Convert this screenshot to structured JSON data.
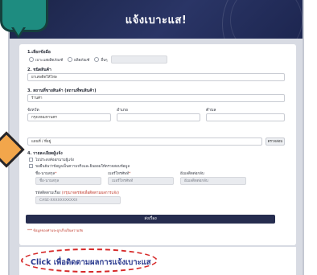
{
  "header": {
    "title": "แจ้งเบาะแส!"
  },
  "form": {
    "section1_label": "1.เลือกข้อมือ",
    "radio_options": [
      "เบาะแสผลิตภัณฑ์",
      "ผลิตภัณฑ์",
      "อื่นๆ"
    ],
    "section2_label": "2. ชนิดสินค้า",
    "product_type_value": "ยาเสพติดให้โทษ",
    "section3_label": "3. สถานที่ขายสินค้า (สถานที่พบสินค้า)",
    "place_value": "ร้านค้า",
    "province_label": "จังหวัด",
    "province_value": "กรุงเทพมหานคร",
    "district_label": "อำเภอ",
    "subdistrict_label": "ตำบล",
    "map_value": "แผนที่ / ที่อยู่",
    "check_button": "ตรวจสอบ",
    "section4_label": "4. รายละเอียดผู้แจ้ง",
    "checkbox1": "ไม่ประสงค์ออกนามผู้แจ้ง",
    "checkbox2": "ขอยืนยันว่าข้อมูลเป็นความจริงและยินยอมให้ตรวจสอบข้อมูล",
    "name_label": "ชื่อ-นามสกุล",
    "name_placeholder": "ชื่อ-นามสกุล",
    "phone_label": "เบอร์โทรศัพท์",
    "phone_placeholder": "เบอร์โทรศัพท์",
    "email_label": "อีเมลติดต่อกลับ",
    "email_placeholder": "อีเมลติดต่อกลับ",
    "tracking_label": "รหัสติดตามเรื่อง",
    "tracking_note": "(กรุณาจดรหัสเพื่อติดตามผลการแจ้ง)",
    "tracking_value": "CASE-XXXXXXXXXXX",
    "submit_label": "ส่งเรื่อง",
    "footer_note": "*** ข้อมูลของท่านจะถูกเก็บเป็นความลับ"
  },
  "bottom": {
    "track_link": "Click เพื่อติดตามผลการแจ้งเบาะแส"
  }
}
